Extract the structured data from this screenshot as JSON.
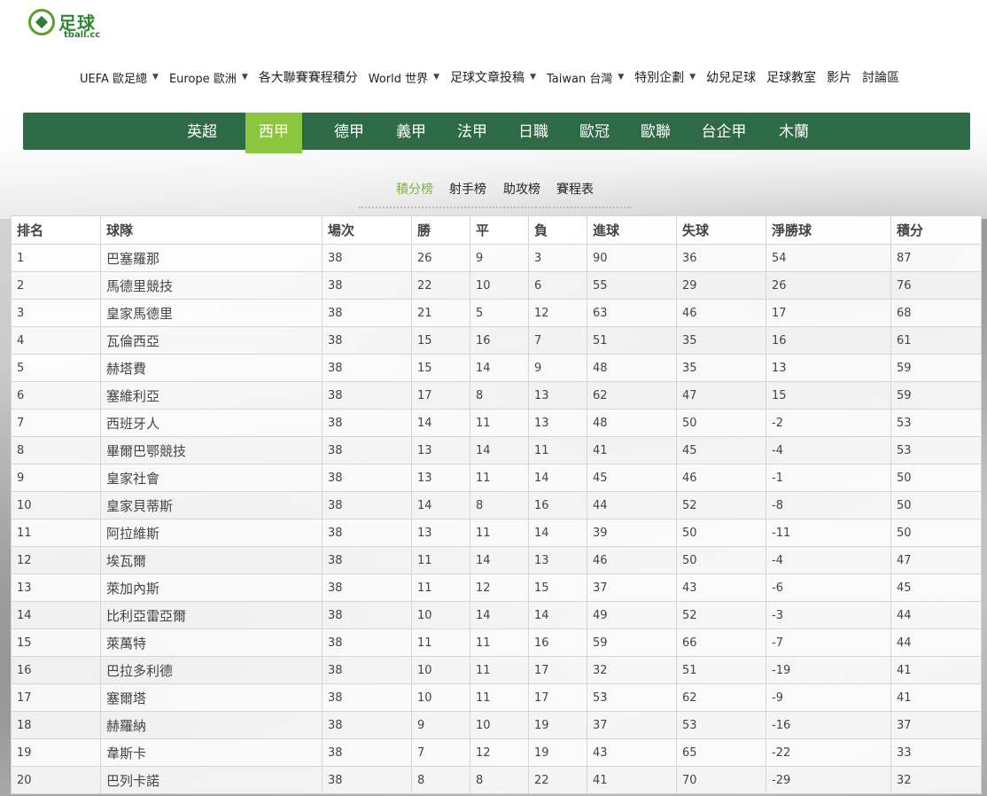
{
  "brand": {
    "logo_cn": "足球",
    "logo_en": "tball.cc"
  },
  "nav": {
    "items": [
      {
        "label": "UEFA 歐足總",
        "dropdown": true
      },
      {
        "label": "Europe 歐洲",
        "dropdown": true
      },
      {
        "label": "各大聯賽賽程積分",
        "dropdown": false
      },
      {
        "label": "World 世界",
        "dropdown": true
      },
      {
        "label": "足球文章投稿",
        "dropdown": true
      },
      {
        "label": "Taiwan 台灣",
        "dropdown": true
      },
      {
        "label": "特別企劃",
        "dropdown": true
      },
      {
        "label": "幼兒足球",
        "dropdown": false
      },
      {
        "label": "足球教室",
        "dropdown": false
      },
      {
        "label": "影片",
        "dropdown": false
      },
      {
        "label": "討論區",
        "dropdown": false
      }
    ]
  },
  "leagues": {
    "active": "西甲",
    "tabs": [
      "英超",
      "西甲",
      "德甲",
      "義甲",
      "法甲",
      "日職",
      "歐冠",
      "歐聯",
      "台企甲",
      "木蘭"
    ]
  },
  "subtabs": {
    "active": "積分榜",
    "items": [
      "積分榜",
      "射手榜",
      "助攻榜",
      "賽程表"
    ]
  },
  "colors": {
    "league_bar": "#2e6a46",
    "active_tab": "#8cc63f",
    "active_subtab": "#7cb342"
  },
  "table": {
    "headers": [
      "排名",
      "球隊",
      "場次",
      "勝",
      "平",
      "負",
      "進球",
      "失球",
      "淨勝球",
      "積分"
    ],
    "rows": [
      [
        "1",
        "巴塞羅那",
        "38",
        "26",
        "9",
        "3",
        "90",
        "36",
        "54",
        "87"
      ],
      [
        "2",
        "馬德里競技",
        "38",
        "22",
        "10",
        "6",
        "55",
        "29",
        "26",
        "76"
      ],
      [
        "3",
        "皇家馬德里",
        "38",
        "21",
        "5",
        "12",
        "63",
        "46",
        "17",
        "68"
      ],
      [
        "4",
        "瓦倫西亞",
        "38",
        "15",
        "16",
        "7",
        "51",
        "35",
        "16",
        "61"
      ],
      [
        "5",
        "赫塔費",
        "38",
        "15",
        "14",
        "9",
        "48",
        "35",
        "13",
        "59"
      ],
      [
        "6",
        "塞維利亞",
        "38",
        "17",
        "8",
        "13",
        "62",
        "47",
        "15",
        "59"
      ],
      [
        "7",
        "西班牙人",
        "38",
        "14",
        "11",
        "13",
        "48",
        "50",
        "-2",
        "53"
      ],
      [
        "8",
        "畢爾巴鄂競技",
        "38",
        "13",
        "14",
        "11",
        "41",
        "45",
        "-4",
        "53"
      ],
      [
        "9",
        "皇家社會",
        "38",
        "13",
        "11",
        "14",
        "45",
        "46",
        "-1",
        "50"
      ],
      [
        "10",
        "皇家貝蒂斯",
        "38",
        "14",
        "8",
        "16",
        "44",
        "52",
        "-8",
        "50"
      ],
      [
        "11",
        "阿拉維斯",
        "38",
        "13",
        "11",
        "14",
        "39",
        "50",
        "-11",
        "50"
      ],
      [
        "12",
        "埃瓦爾",
        "38",
        "11",
        "14",
        "13",
        "46",
        "50",
        "-4",
        "47"
      ],
      [
        "13",
        "萊加內斯",
        "38",
        "11",
        "12",
        "15",
        "37",
        "43",
        "-6",
        "45"
      ],
      [
        "14",
        "比利亞雷亞爾",
        "38",
        "10",
        "14",
        "14",
        "49",
        "52",
        "-3",
        "44"
      ],
      [
        "15",
        "萊萬特",
        "38",
        "11",
        "11",
        "16",
        "59",
        "66",
        "-7",
        "44"
      ],
      [
        "16",
        "巴拉多利德",
        "38",
        "10",
        "11",
        "17",
        "32",
        "51",
        "-19",
        "41"
      ],
      [
        "17",
        "塞爾塔",
        "38",
        "10",
        "11",
        "17",
        "53",
        "62",
        "-9",
        "41"
      ],
      [
        "18",
        "赫羅納",
        "38",
        "9",
        "10",
        "19",
        "37",
        "53",
        "-16",
        "37"
      ],
      [
        "19",
        "韋斯卡",
        "38",
        "7",
        "12",
        "19",
        "43",
        "65",
        "-22",
        "33"
      ],
      [
        "20",
        "巴列卡諾",
        "38",
        "8",
        "8",
        "22",
        "41",
        "70",
        "-29",
        "32"
      ]
    ]
  }
}
